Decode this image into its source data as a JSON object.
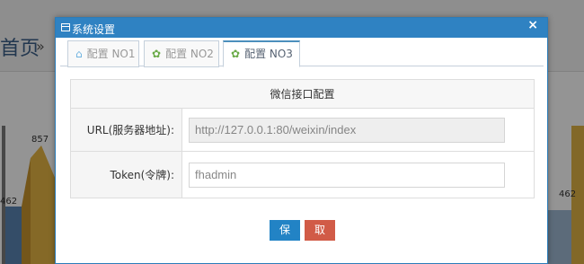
{
  "background": {
    "title": "首页",
    "arrow": "»",
    "chart_labels": [
      "857",
      "462",
      "462"
    ]
  },
  "dialog": {
    "title": "系统设置",
    "close_symbol": "×",
    "tabs": [
      {
        "label": "配置 NO1",
        "icon": "home-icon",
        "active": false
      },
      {
        "label": "配置 NO2",
        "icon": "gear-icon",
        "active": false
      },
      {
        "label": "配置 NO3",
        "icon": "gear-icon",
        "active": true
      }
    ],
    "panel": {
      "heading": "微信接口配置",
      "rows": [
        {
          "label": "URL(服务器地址):",
          "value": "http://127.0.0.1:80/weixin/index",
          "readonly": true
        },
        {
          "label": "Token(令牌):",
          "value": "fhadmin",
          "readonly": false
        }
      ]
    },
    "buttons": {
      "save": "保存",
      "cancel": "取消"
    }
  },
  "colors": {
    "titlebar": "#2f82c2",
    "save_button": "#2283c5",
    "cancel_button": "#d15b47",
    "active_tab_border": "#4c8fbd",
    "gear_icon": "#69aa46"
  }
}
